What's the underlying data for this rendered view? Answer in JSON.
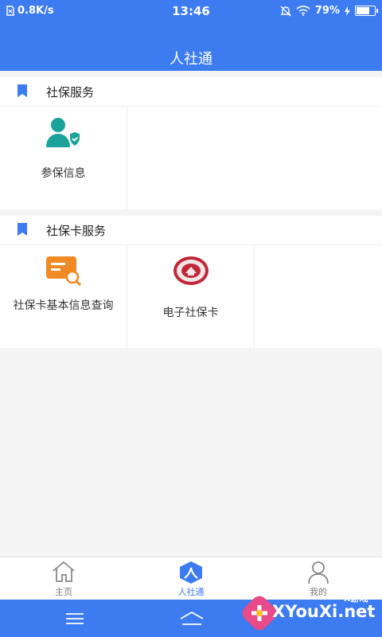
{
  "statusbar": {
    "speed": "0.8K/s",
    "time": "13:46",
    "battery": "79%",
    "battery_level": 0.79
  },
  "appbar": {
    "title": "人社通"
  },
  "sections": [
    {
      "title": "社保服务",
      "items": [
        {
          "label": "参保信息",
          "icon": "person-shield-icon"
        }
      ]
    },
    {
      "title": "社保卡服务",
      "items": [
        {
          "label": "社保卡基本信息查询",
          "icon": "card-search-icon"
        },
        {
          "label": "电子社保卡",
          "icon": "social-security-badge-icon"
        }
      ]
    }
  ],
  "tabs": [
    {
      "label": "主页",
      "icon": "home-icon"
    },
    {
      "label": "人社通",
      "icon": "people-icon",
      "active": true
    },
    {
      "label": "我的",
      "icon": "user-icon"
    }
  ],
  "watermark": {
    "text": "XYouXi.net",
    "small": "X游戏"
  },
  "colors": {
    "primary": "#3d7bf0",
    "teal": "#1aa39a",
    "orange": "#f08a24",
    "badge_red": "#c0283a"
  }
}
